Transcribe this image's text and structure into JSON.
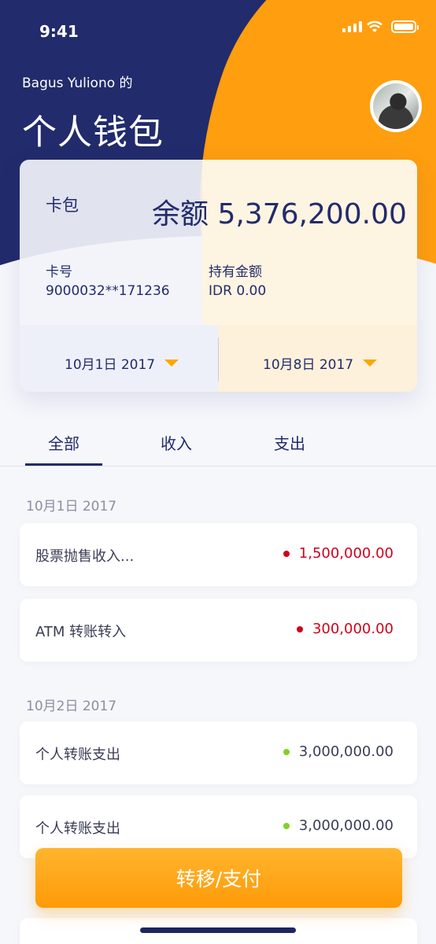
{
  "status": {
    "time": "9:41"
  },
  "header": {
    "owner": "Bagus Yuliono 的",
    "title": "个人钱包"
  },
  "card": {
    "wallet_label": "卡包",
    "balance": "余额 5,376,200.00",
    "card_no_label": "卡号",
    "card_no": "9000032**171236",
    "hold_label": "持有金额",
    "hold_value": "IDR 0.00",
    "date_from": "10月1日 2017",
    "date_to": "10月8日 2017"
  },
  "tabs": [
    {
      "label": "全部"
    },
    {
      "label": "收入"
    },
    {
      "label": "支出"
    }
  ],
  "groups": [
    {
      "date": "10月1日 2017",
      "items": [
        {
          "name": "股票抛售收入...",
          "amount": "1,500,000.00",
          "type": "income"
        },
        {
          "name": "ATM 转账转入",
          "amount": "300,000.00",
          "type": "income"
        }
      ]
    },
    {
      "date": "10月2日 2017",
      "items": [
        {
          "name": "个人转账支出",
          "amount": "3,000,000.00",
          "type": "expense"
        },
        {
          "name": "个人转账支出",
          "amount": "3,000,000.00",
          "type": "expense"
        }
      ]
    }
  ],
  "cta": {
    "label": "转移/支付"
  },
  "colors": {
    "navy": "#222b6b",
    "orange": "#ff9e0f",
    "income": "#d0021b",
    "expense": "#7ed321"
  }
}
